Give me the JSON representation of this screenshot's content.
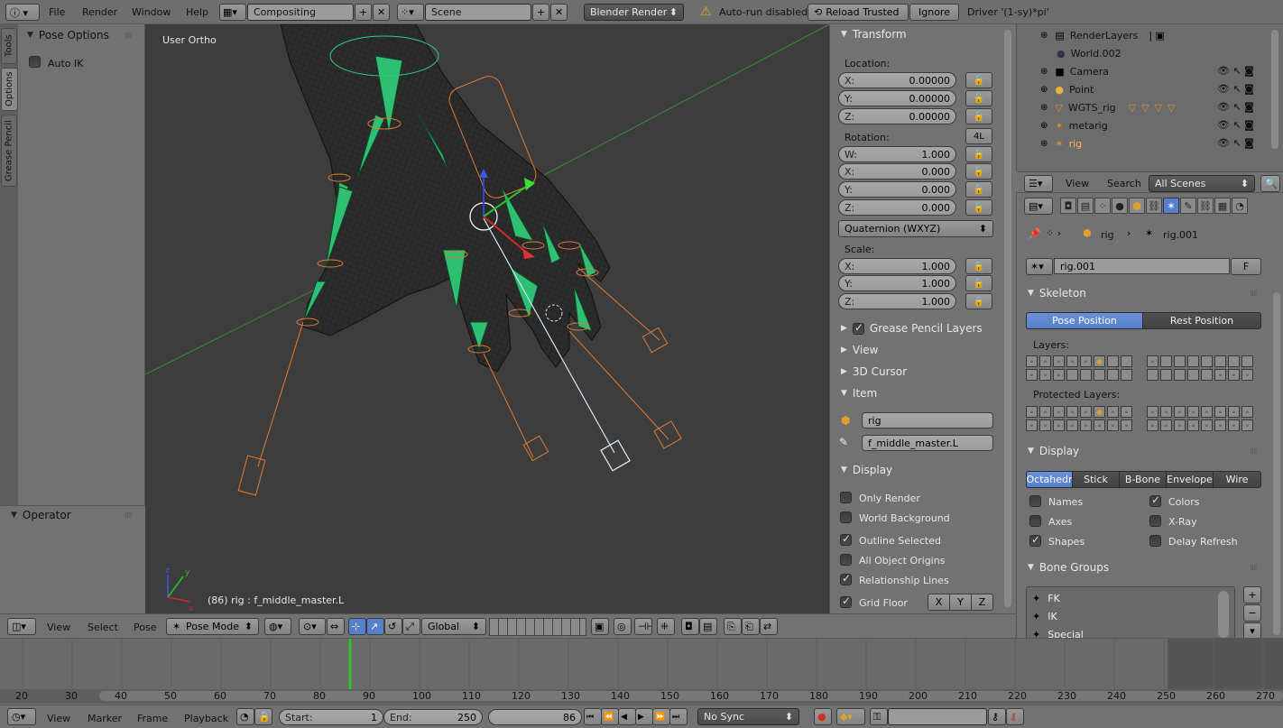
{
  "topbar": {
    "menus": [
      "File",
      "Render",
      "Window",
      "Help"
    ],
    "screen_layout": "Compositing",
    "scene": "Scene",
    "render_engine": "Blender Render",
    "autorun": "Auto-run disabled",
    "reload_trusted": "Reload Trusted",
    "ignore": "Ignore",
    "driver": "Driver '(1-sy)*pi'"
  },
  "toolshelf": {
    "tabs": [
      "Tools",
      "Options",
      "Grease Pencil"
    ],
    "pose_options": "Pose Options",
    "auto_ik": "Auto IK",
    "operator": "Operator"
  },
  "viewport": {
    "view_label": "User Ortho",
    "status": "(86) rig : f_middle_master.L"
  },
  "npanel": {
    "transform": "Transform",
    "location_label": "Location:",
    "location": [
      {
        "l": "X:",
        "v": "0.00000"
      },
      {
        "l": "Y:",
        "v": "0.00000"
      },
      {
        "l": "Z:",
        "v": "0.00000"
      }
    ],
    "rotation_label": "Rotation:",
    "rotation_btn": "4L",
    "rotation": [
      {
        "l": "W:",
        "v": "1.000"
      },
      {
        "l": "X:",
        "v": "0.000"
      },
      {
        "l": "Y:",
        "v": "0.000"
      },
      {
        "l": "Z:",
        "v": "0.000"
      }
    ],
    "rotation_mode": "Quaternion (WXYZ)",
    "scale_label": "Scale:",
    "scale": [
      {
        "l": "X:",
        "v": "1.000"
      },
      {
        "l": "Y:",
        "v": "1.000"
      },
      {
        "l": "Z:",
        "v": "1.000"
      }
    ],
    "grease_pencil_layers": "Grease Pencil Layers",
    "view": "View",
    "cursor": "3D Cursor",
    "item": "Item",
    "item_object": "rig",
    "item_bone": "f_middle_master.L",
    "display": "Display",
    "only_render": "Only Render",
    "world_background": "World Background",
    "outline_selected": "Outline Selected",
    "all_object_origins": "All Object Origins",
    "relationship_lines": "Relationship Lines",
    "grid_floor": "Grid Floor",
    "axes": [
      "X",
      "Y",
      "Z"
    ]
  },
  "outliner": {
    "items": [
      {
        "name": "RenderLayers"
      },
      {
        "name": "World.002"
      },
      {
        "name": "Camera"
      },
      {
        "name": "Point"
      },
      {
        "name": "WGTS_rig"
      },
      {
        "name": "metarig"
      },
      {
        "name": "rig"
      }
    ],
    "view": "View",
    "search": "Search",
    "filter": "All Scenes"
  },
  "properties": {
    "crumb_object": "rig",
    "crumb_data": "rig.001",
    "datablock": "rig.001",
    "fake_user": "F",
    "skeleton": "Skeleton",
    "pose_position": "Pose Position",
    "rest_position": "Rest Position",
    "layers_label": "Layers:",
    "protected_layers_label": "Protected Layers:",
    "display": "Display",
    "display_modes": [
      "Octahedr",
      "Stick",
      "B-Bone",
      "Envelope",
      "Wire"
    ],
    "names": "Names",
    "colors": "Colors",
    "axes": "Axes",
    "xray": "X-Ray",
    "shapes": "Shapes",
    "delay_refresh": "Delay Refresh",
    "bone_groups": "Bone Groups",
    "groups": [
      "FK",
      "IK",
      "Special"
    ]
  },
  "view3d_header": {
    "view": "View",
    "select": "Select",
    "pose": "Pose",
    "mode": "Pose Mode",
    "orientation": "Global"
  },
  "timeline": {
    "ticks": [
      "20",
      "30",
      "40",
      "50",
      "60",
      "70",
      "80",
      "90",
      "100",
      "110",
      "120",
      "130",
      "140",
      "150",
      "160",
      "170",
      "180",
      "190",
      "200",
      "210",
      "220",
      "230",
      "240",
      "250",
      "260",
      "270"
    ],
    "current_frame_value": 86,
    "view": "View",
    "marker": "Marker",
    "frame": "Frame",
    "playback": "Playback",
    "start_label": "Start:",
    "start": "1",
    "end_label": "End:",
    "end": "250",
    "current": "86",
    "sync": "No Sync"
  },
  "colors": {
    "viewport_bg": "#3d3d3d",
    "bone_green": "#2fd07a",
    "bone_orange": "#e07a36",
    "selection_blue": "#5680cc"
  }
}
